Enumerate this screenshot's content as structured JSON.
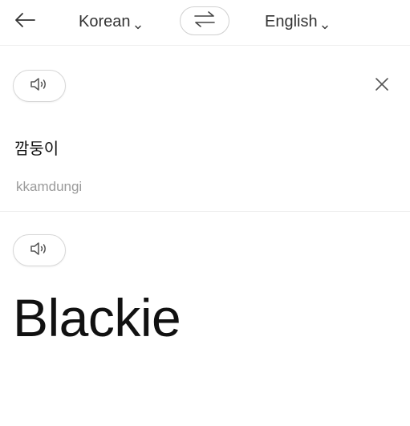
{
  "header": {
    "source_language": "Korean",
    "target_language": "English",
    "icons": {
      "back": "arrow-left-icon",
      "swap": "swap-arrows-icon",
      "chevron": "chevron-down-icon"
    }
  },
  "source": {
    "text": "깜둥이",
    "romanization": "kkamdungi",
    "icons": {
      "speaker": "speaker-icon",
      "close": "close-icon"
    }
  },
  "target": {
    "text": "Blackie",
    "icons": {
      "speaker": "speaker-icon"
    }
  },
  "colors": {
    "text": "#111111",
    "muted": "#9a9a9a",
    "border": "#d7d7d7",
    "divider": "#eeeeee",
    "background": "#ffffff"
  }
}
